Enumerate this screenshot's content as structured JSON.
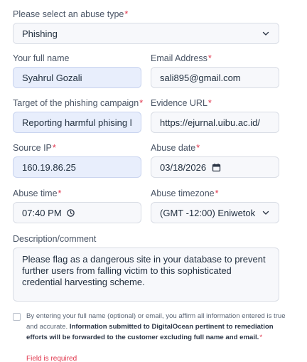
{
  "abuse_type": {
    "label": "Please select an abuse type",
    "value": "Phishing"
  },
  "full_name": {
    "label": "Your full name",
    "value": "Syahrul Gozali"
  },
  "email": {
    "label": "Email Address",
    "value": "sali895@gmail.com"
  },
  "target": {
    "label": "Target of the phishing campaign",
    "value": "Reporting harmful phising link"
  },
  "evidence_url": {
    "label": "Evidence URL",
    "value": "https://ejurnal.uibu.ac.id/"
  },
  "source_ip": {
    "label": "Source IP",
    "value": "160.19.86.25"
  },
  "abuse_date": {
    "label": "Abuse date",
    "value": "03/18/2026"
  },
  "abuse_time": {
    "label": "Abuse time",
    "value": "07:40 PM"
  },
  "abuse_timezone": {
    "label": "Abuse timezone",
    "value": "(GMT -12:00) Eniwetok"
  },
  "description": {
    "label": "Description/comment",
    "value": "Please flag as a dangerous site in your database to prevent further users from falling victim to this sophisticated credential harvesting scheme."
  },
  "consent": {
    "text_plain": "By entering your full name (optional) or email, you affirm all information entered is true and accurate. ",
    "text_bold": "Information submitted to DigitalOcean pertinent to remediation efforts will be forwarded to the customer excluding full name and email.",
    "error": "Field is required"
  },
  "required_marker": "*",
  "colors": {
    "required": "#e0344b",
    "filled_bg": "#e8eefc",
    "field_bg": "#f7f8fb"
  },
  "icons": {
    "select": "chevron-down-icon",
    "date": "calendar-icon",
    "time": "clock-icon"
  }
}
